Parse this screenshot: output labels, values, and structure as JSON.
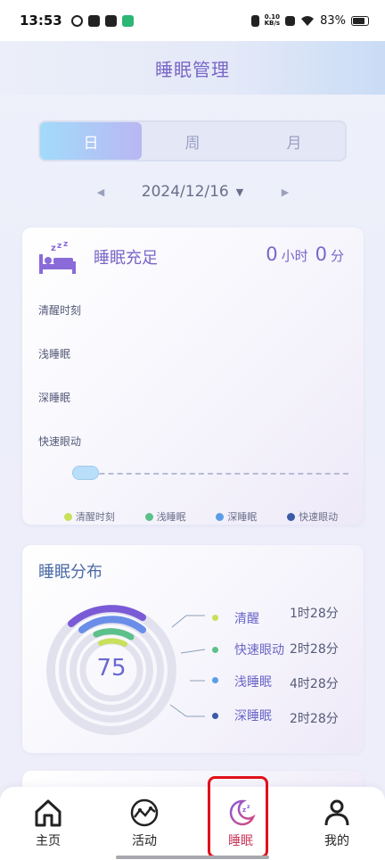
{
  "status_bar": {
    "time": "13:53",
    "net_speed_top": "0.10",
    "net_speed_bottom": "KB/s",
    "battery": "83%",
    "battery_level": 0.83
  },
  "header": {
    "title": "睡眠管理"
  },
  "tabs": [
    {
      "label": "日",
      "active": true
    },
    {
      "label": "周",
      "active": false
    },
    {
      "label": "月",
      "active": false
    }
  ],
  "date_selector": {
    "date": "2024/12/16",
    "prev_icon": "triangle-left-icon",
    "next_icon": "triangle-right-icon",
    "dropdown_icon": "caret-down-icon"
  },
  "sleep_card": {
    "icon": "bed-zzz-icon",
    "title": "睡眠充足",
    "hours": "0",
    "hours_unit": "小时",
    "minutes": "0",
    "minutes_unit": "分",
    "stages": [
      "清醒时刻",
      "浅睡眠",
      "深睡眠",
      "快速眼动"
    ],
    "legend": [
      {
        "label": "清醒时刻",
        "color": "#c8e05a"
      },
      {
        "label": "浅睡眠",
        "color": "#5cc08a"
      },
      {
        "label": "深睡眠",
        "color": "#5a9ee8"
      },
      {
        "label": "快速眼动",
        "color": "#3b5aa8"
      }
    ]
  },
  "distribution_card": {
    "title": "睡眠分布",
    "score": "75",
    "items": [
      {
        "label": "清醒",
        "value": "1时28分",
        "color": "#c8e05a"
      },
      {
        "label": "快速眼动",
        "value": "2时28分",
        "color": "#5cc08a"
      },
      {
        "label": "浅睡眠",
        "value": "4时28分",
        "color": "#5a9ee8"
      },
      {
        "label": "深睡眠",
        "value": "2时28分",
        "color": "#3b5aa8"
      }
    ]
  },
  "bottom_nav": [
    {
      "label": "主页",
      "icon": "home-icon",
      "active": false
    },
    {
      "label": "活动",
      "icon": "activity-icon",
      "active": false
    },
    {
      "label": "睡眠",
      "icon": "sleep-moon-icon",
      "active": true
    },
    {
      "label": "我的",
      "icon": "user-icon",
      "active": false
    }
  ],
  "colors": {
    "accent": "#7a66c7",
    "active_nav": "#cc3a5c",
    "highlight": "#e0101a"
  }
}
